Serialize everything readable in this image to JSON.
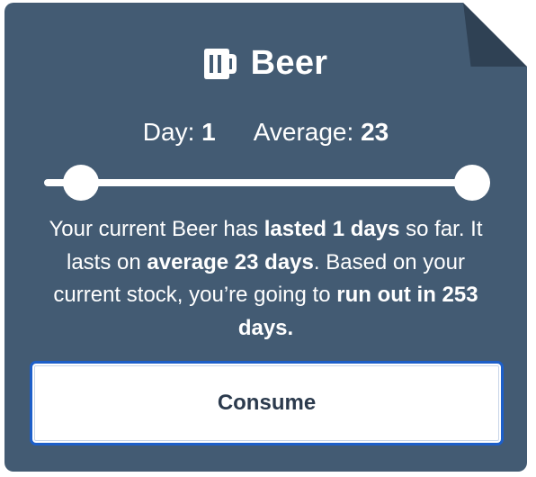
{
  "header": {
    "title": "Beer",
    "icon": "beer-mug-icon"
  },
  "stats": {
    "day_label": "Day:",
    "day_value": "1",
    "average_label": "Average:",
    "average_value": "23"
  },
  "progress_slider": {
    "day": 1,
    "average": 23
  },
  "description": {
    "part1": "Your current Beer has ",
    "bold1": "lasted 1 days",
    "part2": " so far. It lasts on ",
    "bold2": "average 23 days",
    "part3": ". Based on your current stock, you’re going to ",
    "bold3": "run out in 253 days."
  },
  "actions": {
    "consume_label": "Consume"
  },
  "colors": {
    "card_background": "#435b73",
    "fold": "#2f4154",
    "button_border": "#1d5fc9",
    "button_text": "#2b3a4d"
  }
}
